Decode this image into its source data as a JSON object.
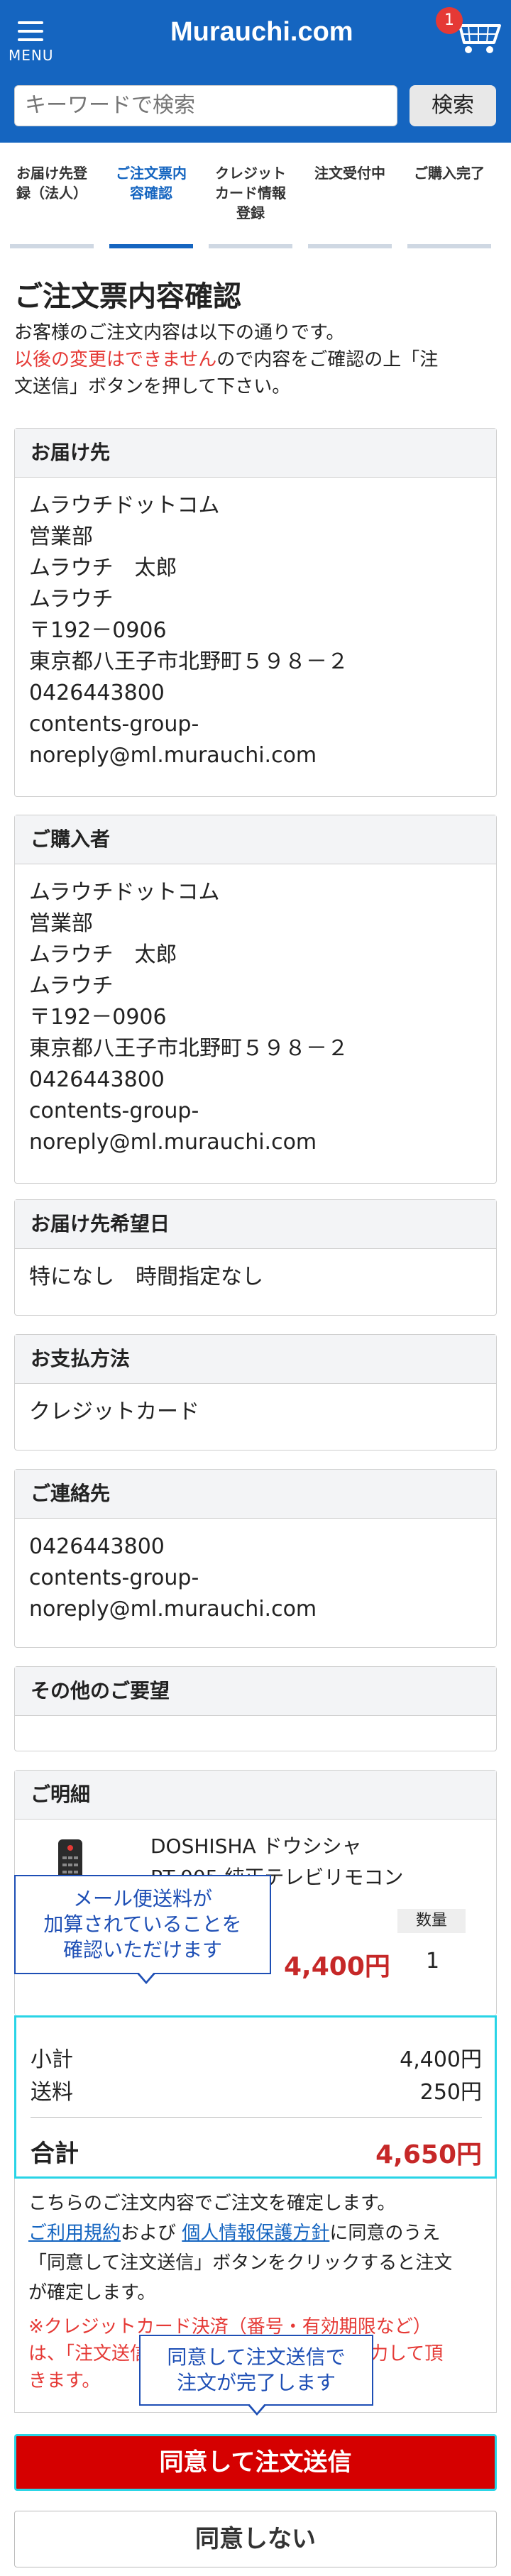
{
  "header": {
    "menu_label": "MENU",
    "logo": "Murauchi.com",
    "cart_count": "1",
    "search_placeholder": "キーワードで検索",
    "search_button": "検索",
    "brand_color": "#1565c0"
  },
  "steps": [
    {
      "line1": "お届け先登",
      "line2": "録（法人）",
      "line3": "",
      "active": false
    },
    {
      "line1": "ご注文票内",
      "line2": "容確認",
      "line3": "",
      "active": true
    },
    {
      "line1": "クレジット",
      "line2": "カード情報",
      "line3": "登録",
      "active": false
    },
    {
      "line1": "注文受付中",
      "line2": "",
      "line3": "",
      "active": false
    },
    {
      "line1": "ご購入完了",
      "line2": "",
      "line3": "",
      "active": false
    }
  ],
  "page": {
    "title": "ご注文票内容確認",
    "intro_line1": "お客様のご注文内容は以下の通りです。",
    "intro_red": "以後の変更はできません",
    "intro_rest1": "ので内容をご確認の上「注",
    "intro_rest2": "文送信」ボタンを押して下さい。"
  },
  "delivery": {
    "heading": "お届け先",
    "lines": [
      "ムラウチドットコム",
      "営業部",
      "ムラウチ　太郎",
      "ムラウチ",
      "〒192－0906",
      "東京都八王子市北野町５９８－２",
      "0426443800",
      "contents-group-",
      "noreply@ml.murauchi.com"
    ]
  },
  "purchaser": {
    "heading": "ご購入者",
    "lines": [
      "ムラウチドットコム",
      "営業部",
      "ムラウチ　太郎",
      "ムラウチ",
      "〒192－0906",
      "東京都八王子市北野町５９８－２",
      "0426443800",
      "contents-group-",
      "noreply@ml.murauchi.com"
    ]
  },
  "delivery_date": {
    "heading": "お届け先希望日",
    "value": "特になし　時間指定なし"
  },
  "payment": {
    "heading": "お支払方法",
    "value": "クレジットカード"
  },
  "contact": {
    "heading": "ご連絡先",
    "lines": [
      "0426443800",
      "contents-group-",
      "noreply@ml.murauchi.com"
    ]
  },
  "requests": {
    "heading": "その他のご要望",
    "value": ""
  },
  "details": {
    "heading": "ご明細",
    "product_line1": "DOSHISHA ドウシシャ",
    "product_line2": "RT-005 純正テレビリモコン",
    "qty_label": "数量",
    "price": "4,400円",
    "qty": "1",
    "tooltip_lines": [
      "メール便送料が",
      "加算されていることを",
      "確認いただけます"
    ]
  },
  "totals": {
    "subtotal_label": "小計",
    "subtotal": "4,400円",
    "shipping_label": "送料",
    "shipping": "250円",
    "total_label": "合計",
    "total": "4,650円"
  },
  "agreement": {
    "line1": "こちらのご注文内容でご注文を確定します。",
    "terms_link": "ご利用規約",
    "and": "および",
    "privacy_link": "個人情報保護方針",
    "line2_rest": "に同意のうえ",
    "line3": "「同意して注文送信」ボタンをクリックすると注文",
    "line4": "が確定します。",
    "note_line1": "※クレジットカード決済（番号・有効期限など）",
    "note_line2": "は、「注文送信」ボタン押下後の画面で入力して頂",
    "note_line3": "きます。",
    "tooltip_lines": [
      "同意して注文送信で",
      "注文が完了します"
    ]
  },
  "buttons": {
    "agree": "同意して注文送信",
    "disagree": "同意しない"
  }
}
